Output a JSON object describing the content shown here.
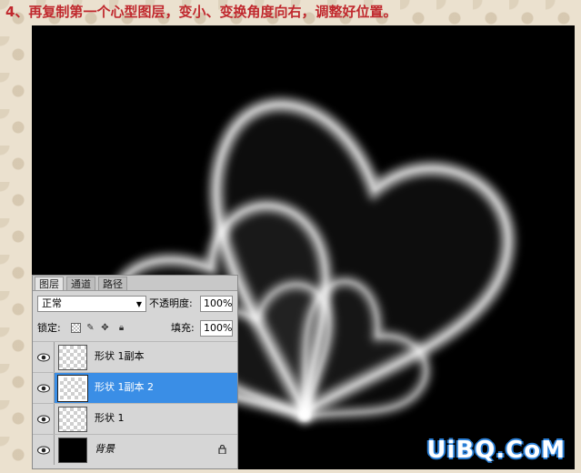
{
  "title": "4、再复制第一个心型图层，变小、变换角度向右，调整好位置。",
  "watermark": "UiBQ.CoM",
  "colors": {
    "title": "#c0282d",
    "canvas_bg": "#000000",
    "selected_layer": "#3a8ee6",
    "watermark_outline": "#2a7fd6"
  },
  "layers_panel": {
    "tabs": [
      {
        "label": "图层",
        "active": true
      },
      {
        "label": "通道",
        "active": false
      },
      {
        "label": "路径",
        "active": false
      }
    ],
    "blend_mode": "正常",
    "opacity_label": "不透明度:",
    "opacity_value": "100%",
    "lock_label": "锁定:",
    "fill_label": "填充:",
    "fill_value": "100%",
    "layers": [
      {
        "name": "形状 1副本",
        "selected": false,
        "visible": true
      },
      {
        "name": "形状 1副本 2",
        "selected": true,
        "visible": true
      },
      {
        "name": "形状 1",
        "selected": false,
        "visible": true
      },
      {
        "name": "背景",
        "selected": false,
        "visible": true,
        "locked": true
      }
    ]
  }
}
